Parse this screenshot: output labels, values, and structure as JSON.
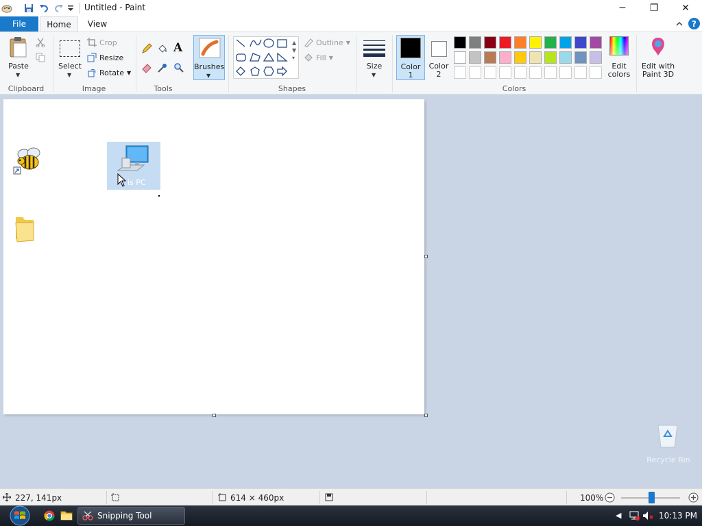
{
  "window": {
    "title": "Untitled - Paint",
    "minimize": "─",
    "maximize": "❐",
    "close": "✕"
  },
  "tabs": {
    "file": "File",
    "home": "Home",
    "view": "View"
  },
  "ribbon": {
    "clipboard": {
      "paste": "Paste",
      "label": "Clipboard"
    },
    "image": {
      "select": "Select",
      "crop": "Crop",
      "resize": "Resize",
      "rotate": "Rotate",
      "label": "Image"
    },
    "tools": {
      "label": "Tools",
      "text_glyph": "A"
    },
    "brushes": {
      "label": "Brushes"
    },
    "shapes": {
      "outline": "Outline",
      "fill": "Fill",
      "label": "Shapes"
    },
    "size": {
      "label": "Size"
    },
    "colors": {
      "color1": "Color",
      "color1_num": "1",
      "color2": "Color",
      "color2_num": "2",
      "edit_colors_1": "Edit",
      "edit_colors_2": "colors",
      "label": "Colors",
      "palette_row1": [
        "#000000",
        "#7f7f7f",
        "#880015",
        "#ed1c24",
        "#ff7f27",
        "#fff200",
        "#22b14c",
        "#00a2e8",
        "#3f48cc",
        "#a349a4"
      ],
      "palette_row2": [
        "#ffffff",
        "#c3c3c3",
        "#b97a57",
        "#ffaec9",
        "#ffc90e",
        "#efe4b0",
        "#b5e61d",
        "#99d9ea",
        "#7092be",
        "#c8bfe7"
      ]
    },
    "paint3d": {
      "line1": "Edit with",
      "line2": "Paint 3D"
    }
  },
  "canvas": {
    "this_pc_label": "is PC",
    "recycle_bin_label": "Recycle Bin"
  },
  "status": {
    "cursor_pos": "227, 141px",
    "canvas_size": "614 × 460px",
    "zoom": "100%"
  },
  "taskbar": {
    "snipping_tool": "Snipping Tool",
    "clock": "10:13 PM"
  }
}
